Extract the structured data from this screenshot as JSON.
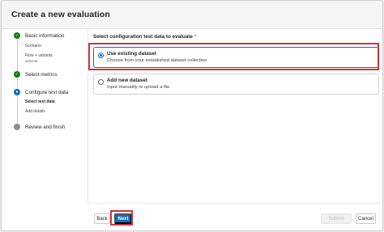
{
  "dialog": {
    "title": "Create a new evaluation"
  },
  "steps": [
    {
      "label": "Basic information",
      "status": "done",
      "substeps": [
        {
          "label": "Scenario"
        },
        {
          "label": "Flow + variants",
          "note": "optional"
        }
      ]
    },
    {
      "label": "Select metrics",
      "status": "done"
    },
    {
      "label": "Configure test data",
      "status": "current",
      "substeps": [
        {
          "label": "Select test data"
        },
        {
          "label": "Add details"
        }
      ]
    },
    {
      "label": "Review and finish",
      "status": "pending"
    }
  ],
  "main": {
    "section_label": "Select configuration test data to evaluate",
    "required_mark": "*",
    "options": [
      {
        "title": "Use existing dataset",
        "desc": "Choose from your established dataset collection",
        "selected": true
      },
      {
        "title": "Add new dataset",
        "desc": "Input manually or upload a file",
        "selected": false
      }
    ]
  },
  "footer": {
    "back": "Back",
    "next": "Next",
    "submit": "Submit",
    "cancel": "Cancel"
  },
  "colors": {
    "accent": "#0f6cbd",
    "done": "#107c10",
    "highlight": "#d13438"
  }
}
